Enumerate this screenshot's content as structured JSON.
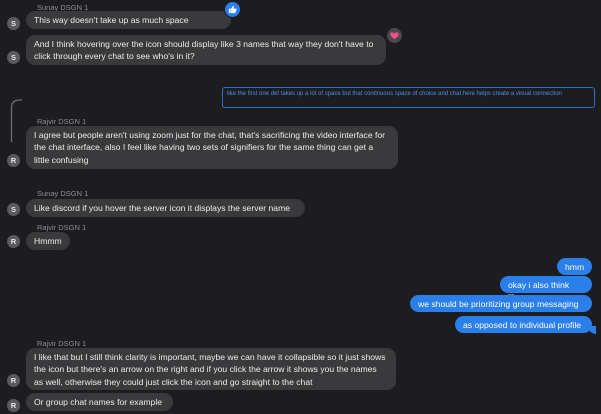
{
  "messages": [
    {
      "sender": "Sunay DSGN 1",
      "avatar": "S",
      "text": "This way doesn't take up as much space",
      "reaction": "thumbs-up-icon"
    },
    {
      "avatar": "S",
      "text": "And I think hovering over the icon should display like 3 names that way they don't have to click through every chat to see who's in it?",
      "reaction": "heart-icon"
    },
    {
      "reply_preview": "like the first one def takes up a lot of space but that continuous space of choice and chat here helps create a visual connection"
    },
    {
      "sender": "Rajvir DSGN 1",
      "avatar": "R",
      "text": "I agree but people aren't using zoom just for the chat, that's sacrificing the video interface for the chat interface, also I feel like having two sets of signifiers for the same thing can get a little confusing"
    },
    {
      "sender": "Sunay DSGN 1",
      "avatar": "S",
      "text": "Like discord if you hover the server icon it displays the server name"
    },
    {
      "sender": "Rajvir DSGN 1",
      "avatar": "R",
      "text": "Hmmm"
    },
    {
      "me": true,
      "text": "hmm"
    },
    {
      "me": true,
      "text": "okay i also think like"
    },
    {
      "me": true,
      "text": "we should be prioritizing group messaging"
    },
    {
      "me": true,
      "text": "as opposed to individual profile"
    },
    {
      "sender": "Rajvir DSGN 1",
      "avatar": "R",
      "text": "I like that but I still think clarity is important, maybe we can have it collapsible so it just shows the icon but there's an arrow on the right and if you click the arrow it shows you the names as well, otherwise they could just click the icon and go straight to the chat"
    },
    {
      "avatar": "R",
      "text": "Or group chat names for example"
    }
  ],
  "colors": {
    "background": "#1d1d1f",
    "incoming_bubble": "#3a3a3c",
    "outgoing_bubble": "#2b7fe8",
    "avatar": "#5a5a5e",
    "sender_name": "#8e8e93"
  }
}
